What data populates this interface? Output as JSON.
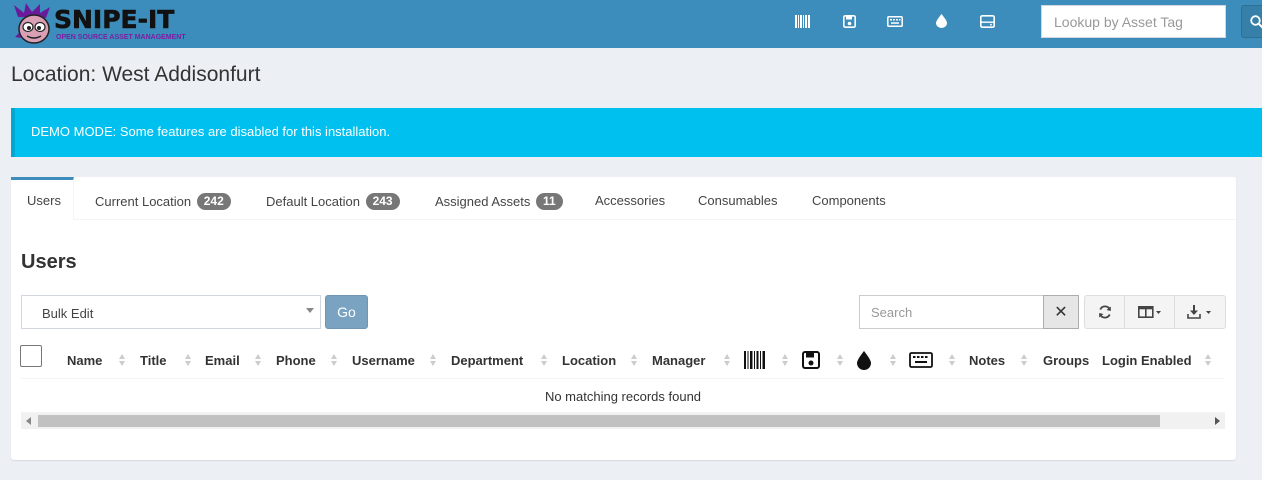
{
  "header": {
    "logo_title": "SNIPE-IT",
    "logo_subtitle": "OPEN SOURCE ASSET MANAGEMENT",
    "nav_icons": [
      "barcode-icon",
      "floppy-disk-icon",
      "keyboard-icon",
      "tint-drop-icon",
      "hdd-icon"
    ],
    "asset_tag_placeholder": "Lookup by Asset Tag",
    "colors": {
      "bar": "#3c8dbc"
    }
  },
  "page": {
    "title": "Location: West Addisonfurt"
  },
  "alert": {
    "text": "DEMO MODE: Some features are disabled for this installation."
  },
  "tabs": [
    {
      "label": "Users",
      "active": true
    },
    {
      "label": "Current Location",
      "badge": "242"
    },
    {
      "label": "Default Location",
      "badge": "243"
    },
    {
      "label": "Assigned Assets",
      "badge": "11"
    },
    {
      "label": "Accessories"
    },
    {
      "label": "Consumables"
    },
    {
      "label": "Components"
    }
  ],
  "users_panel": {
    "title": "Users",
    "bulk_select_value": "Bulk Edit",
    "go_label": "Go",
    "search_placeholder": "Search",
    "clear_label": "✕",
    "columns": [
      "Name",
      "Title",
      "Email",
      "Phone",
      "Username",
      "Department",
      "Location",
      "Manager",
      "Notes",
      "Groups",
      "Login Enabled"
    ],
    "icon_columns": [
      "barcode-icon",
      "floppy-disk-icon",
      "tint-drop-icon",
      "keyboard-icon"
    ],
    "empty_text": "No matching records found"
  }
}
